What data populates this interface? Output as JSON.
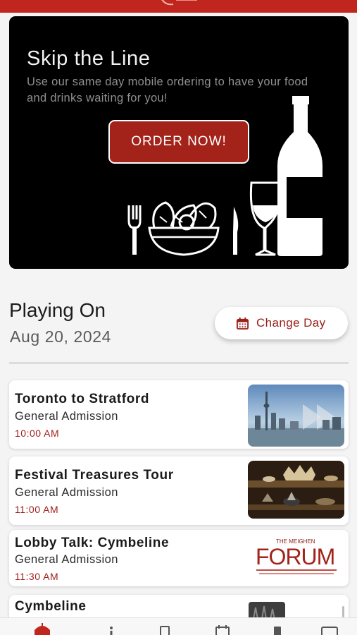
{
  "promo": {
    "title": "Skip the Line",
    "subtitle": "Use our same day mobile ordering to have your food and drinks waiting for you!",
    "button_label": "ORDER NOW!"
  },
  "schedule": {
    "heading": "Playing On",
    "date": "Aug 20, 2024",
    "change_day_label": "Change Day"
  },
  "events": [
    {
      "title": "Toronto to Stratford",
      "admission": "General Admission",
      "time": "10:00 AM",
      "image": "toronto-skyline"
    },
    {
      "title": "Festival Treasures Tour",
      "admission": "General Admission",
      "time": "11:00 AM",
      "image": "crowns-display"
    },
    {
      "title": "Lobby Talk: Cymbeline",
      "admission": "General Admission",
      "time": "11:30 AM",
      "image": "forum-logo",
      "image_text": {
        "small": "THE MEIGHEN",
        "big": "FORUM"
      }
    },
    {
      "title": "Cymbeline",
      "admission": "",
      "time": "",
      "image": "cymbeline-poster"
    }
  ],
  "nav": [
    "festival-icon",
    "info-icon",
    "ticket-icon",
    "calendar-icon",
    "menu-icon",
    "account-icon"
  ],
  "colors": {
    "brand_red": "#c0261d",
    "accent_red": "#a32219",
    "text_dark": "#1c1c1c"
  }
}
